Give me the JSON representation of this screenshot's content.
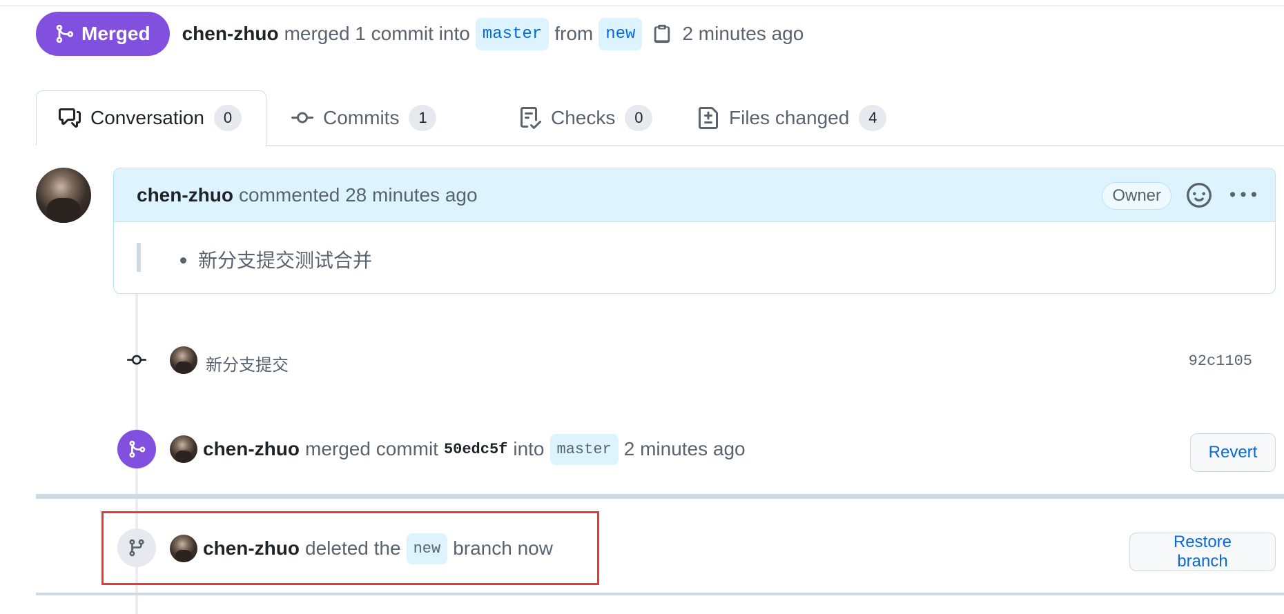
{
  "header": {
    "state": "Merged",
    "author": "chen-zhuo",
    "merged_text": "merged 1 commit into",
    "base_branch": "master",
    "from_text": "from",
    "head_branch": "new",
    "time": "2 minutes ago"
  },
  "tabs": [
    {
      "label": "Conversation",
      "count": "0"
    },
    {
      "label": "Commits",
      "count": "1"
    },
    {
      "label": "Checks",
      "count": "0"
    },
    {
      "label": "Files changed",
      "count": "4"
    }
  ],
  "comment": {
    "author": "chen-zhuo",
    "meta": "commented 28 minutes ago",
    "role": "Owner",
    "body_item": "新分支提交测试合并"
  },
  "commit": {
    "message": "新分支提交",
    "sha": "92c1105"
  },
  "merge_event": {
    "author": "chen-zhuo",
    "text1": "merged commit",
    "sha": "50edc5f",
    "text2": "into",
    "branch": "master",
    "time": "2 minutes ago",
    "button": "Revert"
  },
  "delete_event": {
    "author": "chen-zhuo",
    "text1": "deleted the",
    "branch": "new",
    "text2": "branch now",
    "button": "Restore branch"
  },
  "colors": {
    "merged_purple": "#8250df",
    "link_blue": "#0969da",
    "highlight_red": "#e53935"
  }
}
